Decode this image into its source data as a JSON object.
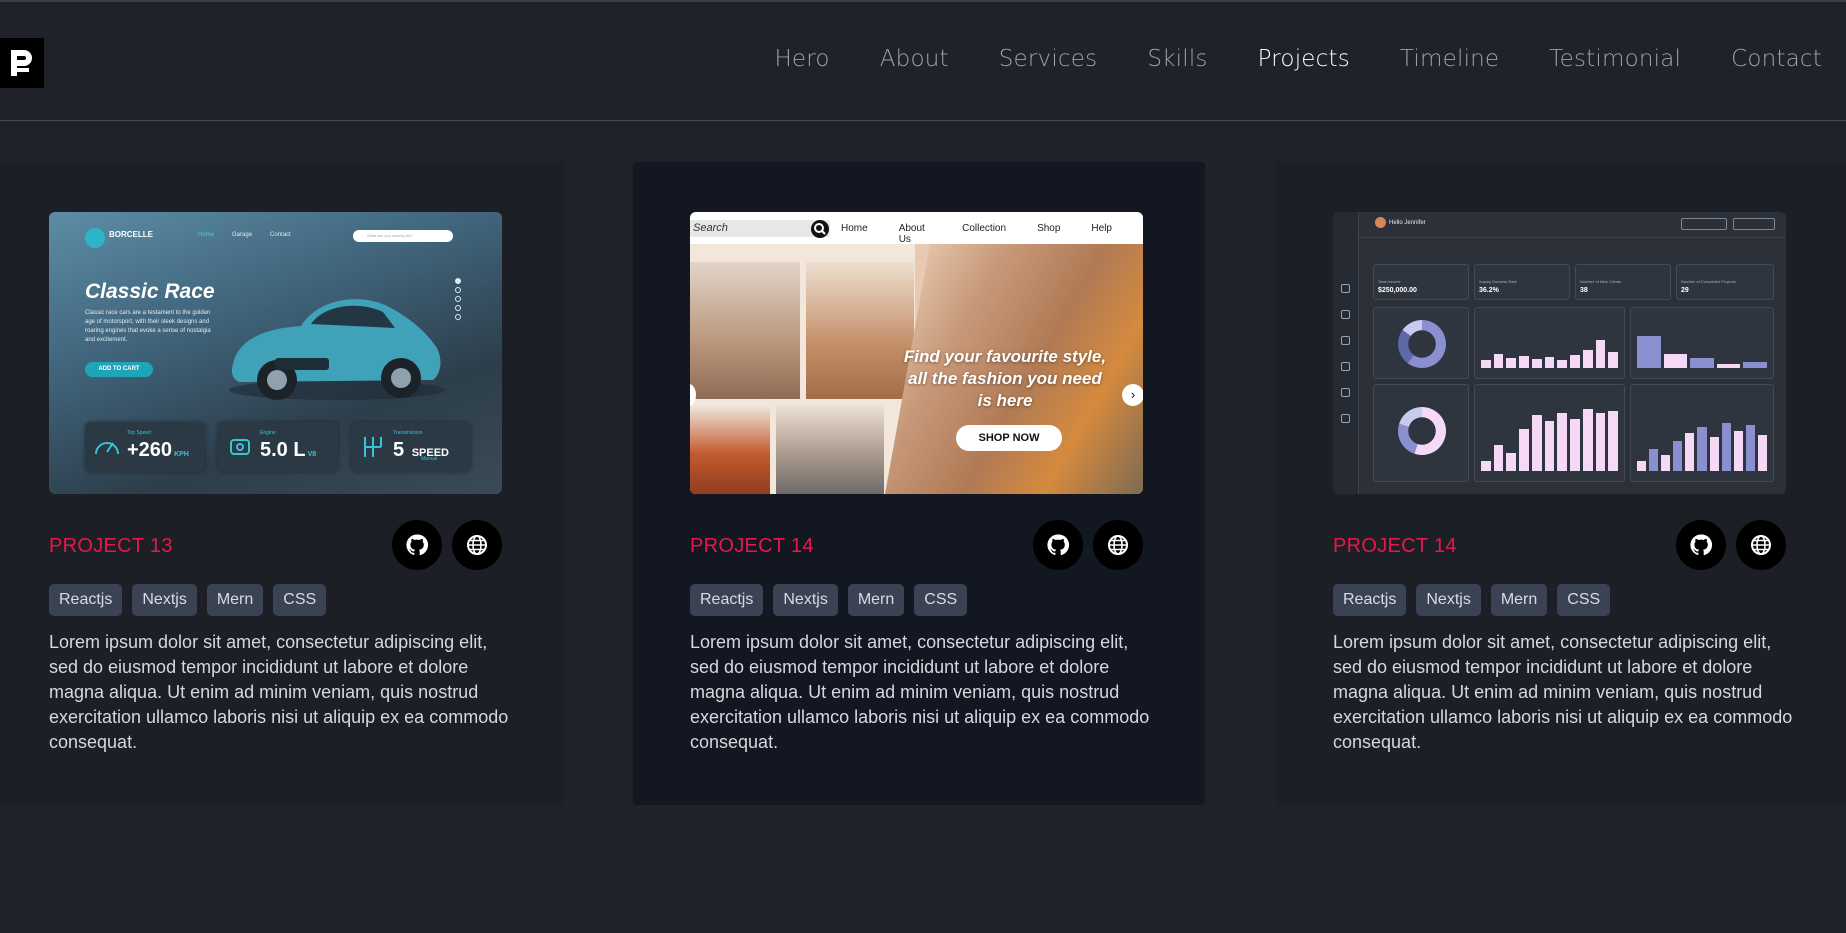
{
  "header": {
    "logo_alt": "P",
    "nav": [
      "Hero",
      "About",
      "Services",
      "Skills",
      "Projects",
      "Timeline",
      "Testimonial",
      "Contact"
    ],
    "active": "Projects"
  },
  "colors": {
    "accent": "#e8174b",
    "bg": "#1f2228",
    "tag_bg": "#3b4254"
  },
  "projects": [
    {
      "title": "PROJECT 13",
      "tags": [
        "Reactjs",
        "Nextjs",
        "Mern",
        "CSS"
      ],
      "description": "Lorem ipsum dolor sit amet, consectetur adipiscing elit, sed do eiusmod tempor incididunt ut labore et dolore magna aliqua. Ut enim ad minim veniam, quis nostrud exercitation ullamco laboris nisi ut aliquip ex ea commodo consequat.",
      "thumb": {
        "brand": "BORCELLE",
        "nav": [
          "Home",
          "Garage",
          "Contact"
        ],
        "search_placeholder": "What are you looking for?",
        "heading": "Classic Race",
        "subtitle": "Classic race cars are a testament to the golden age of motorsport, with their sleek designs and roaring engines that evoke a sense of nostalgia and excitement.",
        "cta": "ADD TO CART",
        "stats": [
          {
            "caption": "Top Speed",
            "value": "+260",
            "unit": "KPH"
          },
          {
            "caption": "Engine",
            "value": "5.0 L",
            "unit": "V8"
          },
          {
            "caption": "Transmission",
            "value": "5",
            "unit": "SPEED"
          }
        ],
        "transmission_note": "Manual"
      }
    },
    {
      "title": "PROJECT 14",
      "tags": [
        "Reactjs",
        "Nextjs",
        "Mern",
        "CSS"
      ],
      "description": "Lorem ipsum dolor sit amet, consectetur adipiscing elit, sed do eiusmod tempor incididunt ut labore et dolore magna aliqua. Ut enim ad minim veniam, quis nostrud exercitation ullamco laboris nisi ut aliquip ex ea commodo consequat.",
      "thumb": {
        "search": "Search",
        "nav": [
          "Home",
          "About Us",
          "Collection",
          "Shop",
          "Help"
        ],
        "headline": "Find your favourite style, all the fashion you need is here",
        "cta": "SHOP NOW"
      }
    },
    {
      "title": "PROJECT 14",
      "tags": [
        "Reactjs",
        "Nextjs",
        "Mern",
        "CSS"
      ],
      "description": "Lorem ipsum dolor sit amet, consectetur adipiscing elit, sed do eiusmod tempor incididunt ut labore et dolore magna aliqua. Ut enim ad minim veniam, quis nostrud exercitation ullamco laboris nisi ut aliquip ex ea commodo consequat.",
      "thumb": {
        "greeting": "Hello Jennifer",
        "kpis": [
          {
            "label": "Total Income",
            "value": "$250,000.00"
          },
          {
            "label": "Inquiry Success Rate",
            "value": "36.2%"
          },
          {
            "label": "Number of New Clients",
            "value": "38"
          },
          {
            "label": "Number of Completed Projects",
            "value": "29"
          }
        ]
      }
    }
  ],
  "icons": {
    "github": "github-icon",
    "website": "globe-icon"
  }
}
